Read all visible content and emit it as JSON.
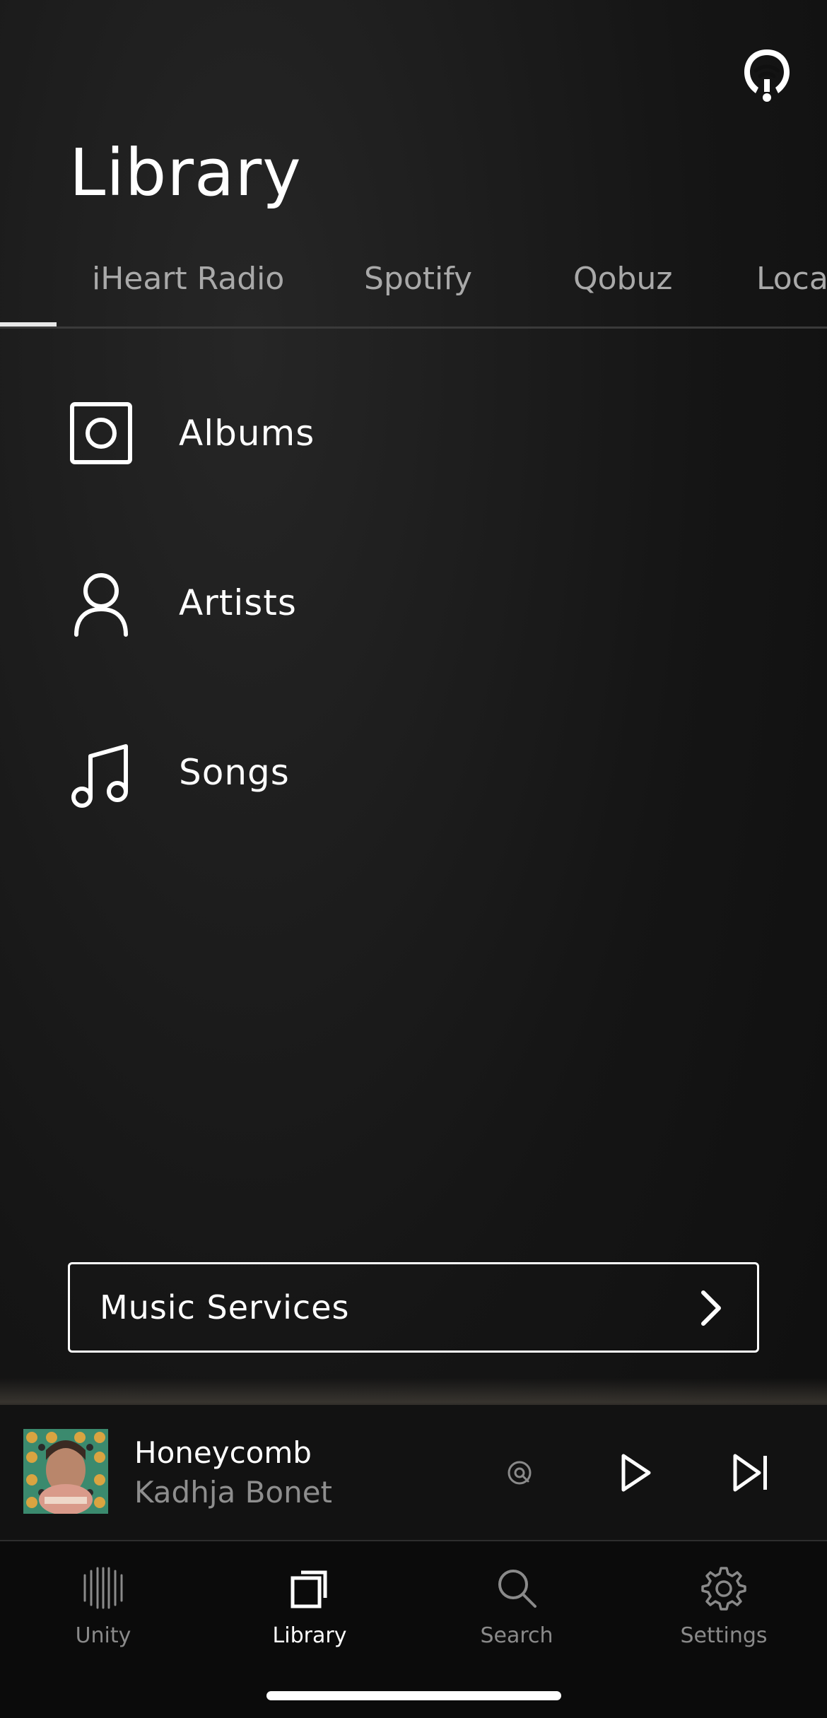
{
  "header": {
    "title": "Library",
    "group_icon": "speaker-group-icon"
  },
  "tabs": [
    {
      "label": "iHeart Radio",
      "active": true
    },
    {
      "label": "Spotify",
      "active": false
    },
    {
      "label": "Qobuz",
      "active": false
    },
    {
      "label": "Loca",
      "active": false
    }
  ],
  "library_items": [
    {
      "label": "Albums",
      "icon": "album-icon"
    },
    {
      "label": "Artists",
      "icon": "person-icon"
    },
    {
      "label": "Songs",
      "icon": "music-note-icon"
    }
  ],
  "music_services": {
    "label": "Music Services",
    "icon": "chevron-right-icon"
  },
  "now_playing": {
    "title": "Honeycomb",
    "artist": "Kadhja Bonet",
    "cast_icon": "cast-icon",
    "play_icon": "play-icon",
    "next_icon": "skip-next-icon"
  },
  "bottom_nav": [
    {
      "label": "Unity",
      "icon": "unity-icon",
      "active": false
    },
    {
      "label": "Library",
      "icon": "library-icon",
      "active": true
    },
    {
      "label": "Search",
      "icon": "search-icon",
      "active": false
    },
    {
      "label": "Settings",
      "icon": "gear-icon",
      "active": false
    }
  ],
  "colors": {
    "background": "#101010",
    "text_primary": "#ffffff",
    "text_inactive": "#a9a9a9",
    "text_secondary": "#8e8e8e"
  }
}
